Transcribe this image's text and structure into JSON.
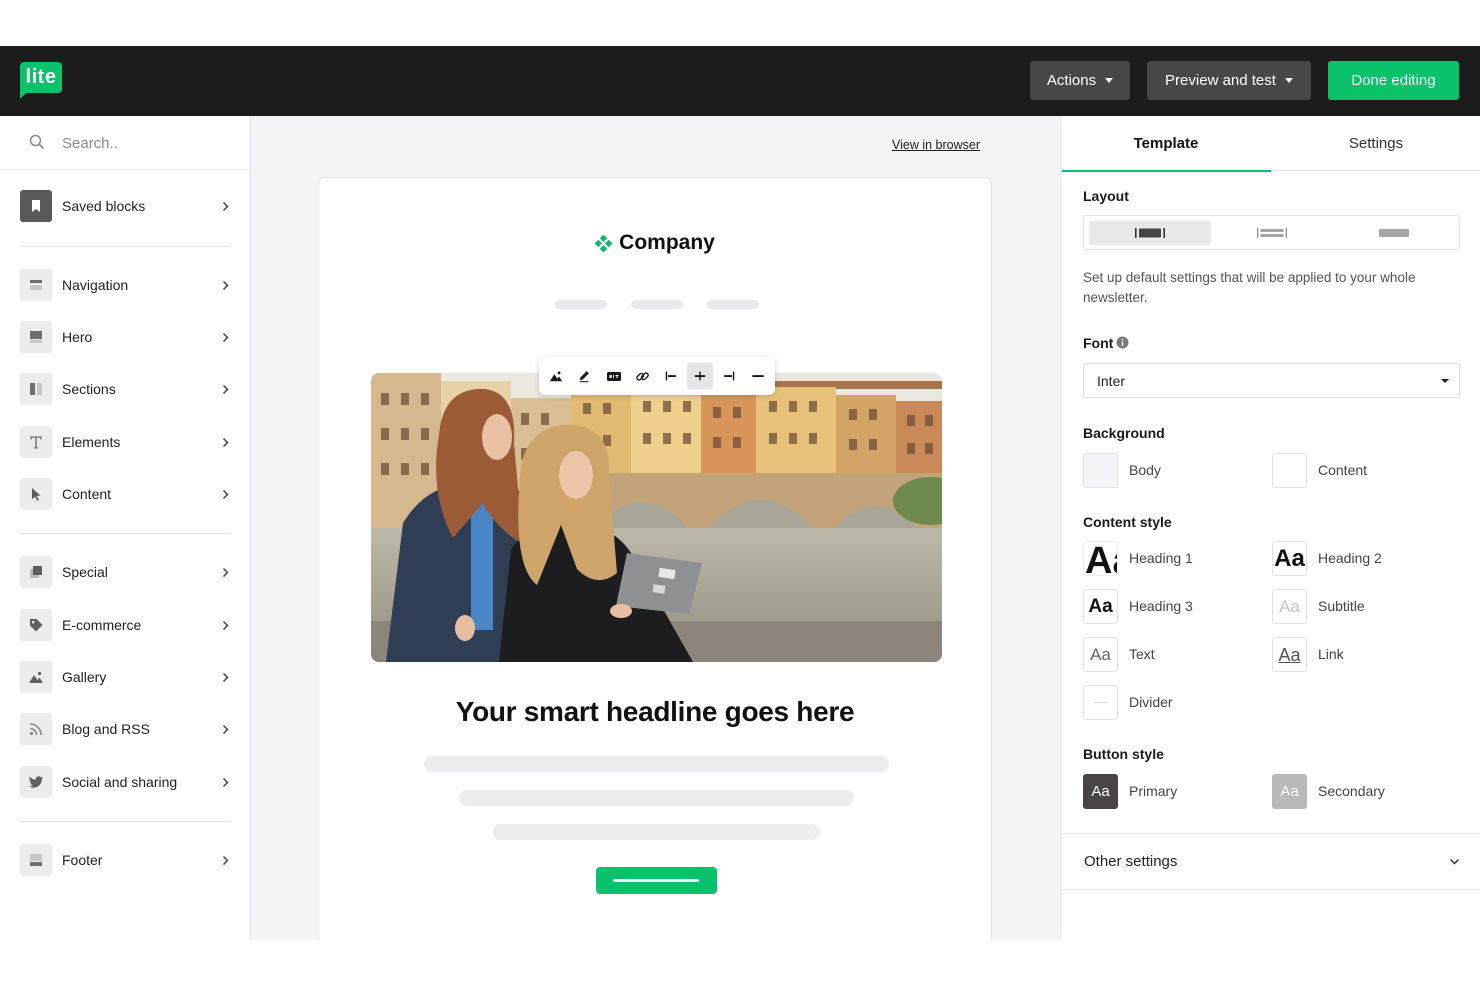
{
  "colors": {
    "accent": "#09c269",
    "header_bg": "#1c1c1c",
    "canvas_bg": "#f2f4f7",
    "primary_button": "#4b4444",
    "secondary_button": "#b9b9b9"
  },
  "header": {
    "logo_text": "lite",
    "actions": "Actions",
    "preview": "Preview and test",
    "done": "Done editing"
  },
  "sidebar": {
    "search_placeholder": "Search..",
    "items": [
      {
        "label": "Saved blocks",
        "icon": "bookmark-icon"
      },
      {
        "label": "Navigation",
        "icon": "navigation-block-icon"
      },
      {
        "label": "Hero",
        "icon": "hero-block-icon"
      },
      {
        "label": "Sections",
        "icon": "columns-icon"
      },
      {
        "label": "Elements",
        "icon": "text-icon"
      },
      {
        "label": "Content",
        "icon": "cursor-icon"
      },
      {
        "label": "Special",
        "icon": "layers-icon"
      },
      {
        "label": "E-commerce",
        "icon": "tag-icon"
      },
      {
        "label": "Gallery",
        "icon": "image-icon"
      },
      {
        "label": "Blog and RSS",
        "icon": "rss-icon"
      },
      {
        "label": "Social and sharing",
        "icon": "twitter-icon"
      },
      {
        "label": "Footer",
        "icon": "footer-block-icon"
      }
    ]
  },
  "canvas": {
    "view_in_browser": "View in browser",
    "email": {
      "company": "Company",
      "headline": "Your smart headline goes here",
      "toolbar": [
        "image-icon",
        "pencil-icon",
        "alt-text-icon",
        "link-icon",
        "align-left-icon",
        "align-center-icon",
        "align-right-icon",
        "full-width-icon"
      ],
      "toolbar_active": "align-center-icon"
    }
  },
  "panel": {
    "tabs": [
      {
        "label": "Template",
        "active": true
      },
      {
        "label": "Settings",
        "active": false
      }
    ],
    "layout": {
      "label": "Layout",
      "options": [
        "layout-narrow-icon",
        "layout-medium-icon",
        "layout-wide-icon"
      ],
      "selected": 0
    },
    "description": "Set up default settings that will be applied to your whole newsletter.",
    "font": {
      "label": "Font",
      "value": "Inter"
    },
    "background": {
      "label": "Background",
      "items": [
        {
          "label": "Body",
          "color": "#f3f5f8"
        },
        {
          "label": "Content",
          "color": "#ffffff"
        }
      ]
    },
    "content_style": {
      "label": "Content style",
      "sample": "Aa",
      "items": [
        "Heading 1",
        "Heading 2",
        "Heading 3",
        "Subtitle",
        "Text",
        "Link",
        "Divider"
      ]
    },
    "button_style": {
      "label": "Button style",
      "sample": "Aa",
      "items": [
        "Primary",
        "Secondary"
      ]
    },
    "other_settings": "Other settings"
  }
}
